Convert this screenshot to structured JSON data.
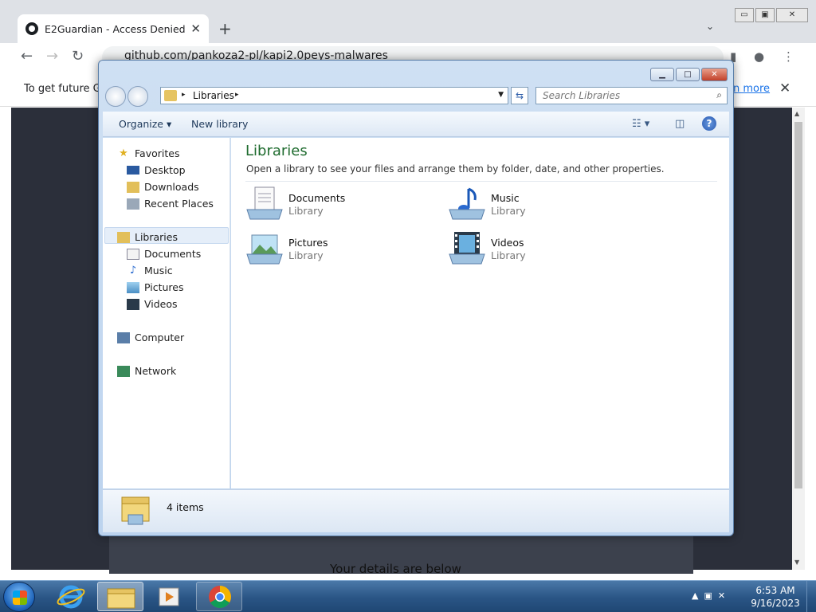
{
  "browser": {
    "tab_title": "E2Guardian - Access Denied",
    "tab_close": "✕",
    "new_tab": "+",
    "tab_search": "⌄",
    "window_min": "▭",
    "window_max": "▣",
    "window_close": "✕",
    "url": "github.com/pankoza2-pl/kapi2.0peys-malwares",
    "infobar_text": "To get future Go",
    "infobar_link": "n more",
    "infobar_close": "✕",
    "page_text": "Your details are below"
  },
  "explorer": {
    "controls": {
      "minimize": "▁",
      "maximize": "□",
      "close": "✕"
    },
    "address": {
      "crumb": "Libraries",
      "sep": "▸"
    },
    "search_placeholder": "Search Libraries",
    "commands": {
      "organize": "Organize ▾",
      "new_library": "New library"
    },
    "nav": {
      "favorites": "Favorites",
      "desktop": "Desktop",
      "downloads": "Downloads",
      "recent_places": "Recent Places",
      "libraries": "Libraries",
      "documents": "Documents",
      "music": "Music",
      "pictures": "Pictures",
      "videos": "Videos",
      "computer": "Computer",
      "network": "Network"
    },
    "main": {
      "title": "Libraries",
      "subtitle": "Open a library to see your files and arrange them by folder, date, and other properties.",
      "libraries": [
        {
          "name": "Documents",
          "kind": "Library"
        },
        {
          "name": "Music",
          "kind": "Library"
        },
        {
          "name": "Pictures",
          "kind": "Library"
        },
        {
          "name": "Videos",
          "kind": "Library"
        }
      ]
    },
    "status": {
      "count": "4 items"
    }
  },
  "taskbar": {
    "time": "6:53 AM",
    "date": "9/16/2023"
  },
  "colors": {
    "library_title": "#1e6b2e",
    "link": "#1a73e8"
  }
}
